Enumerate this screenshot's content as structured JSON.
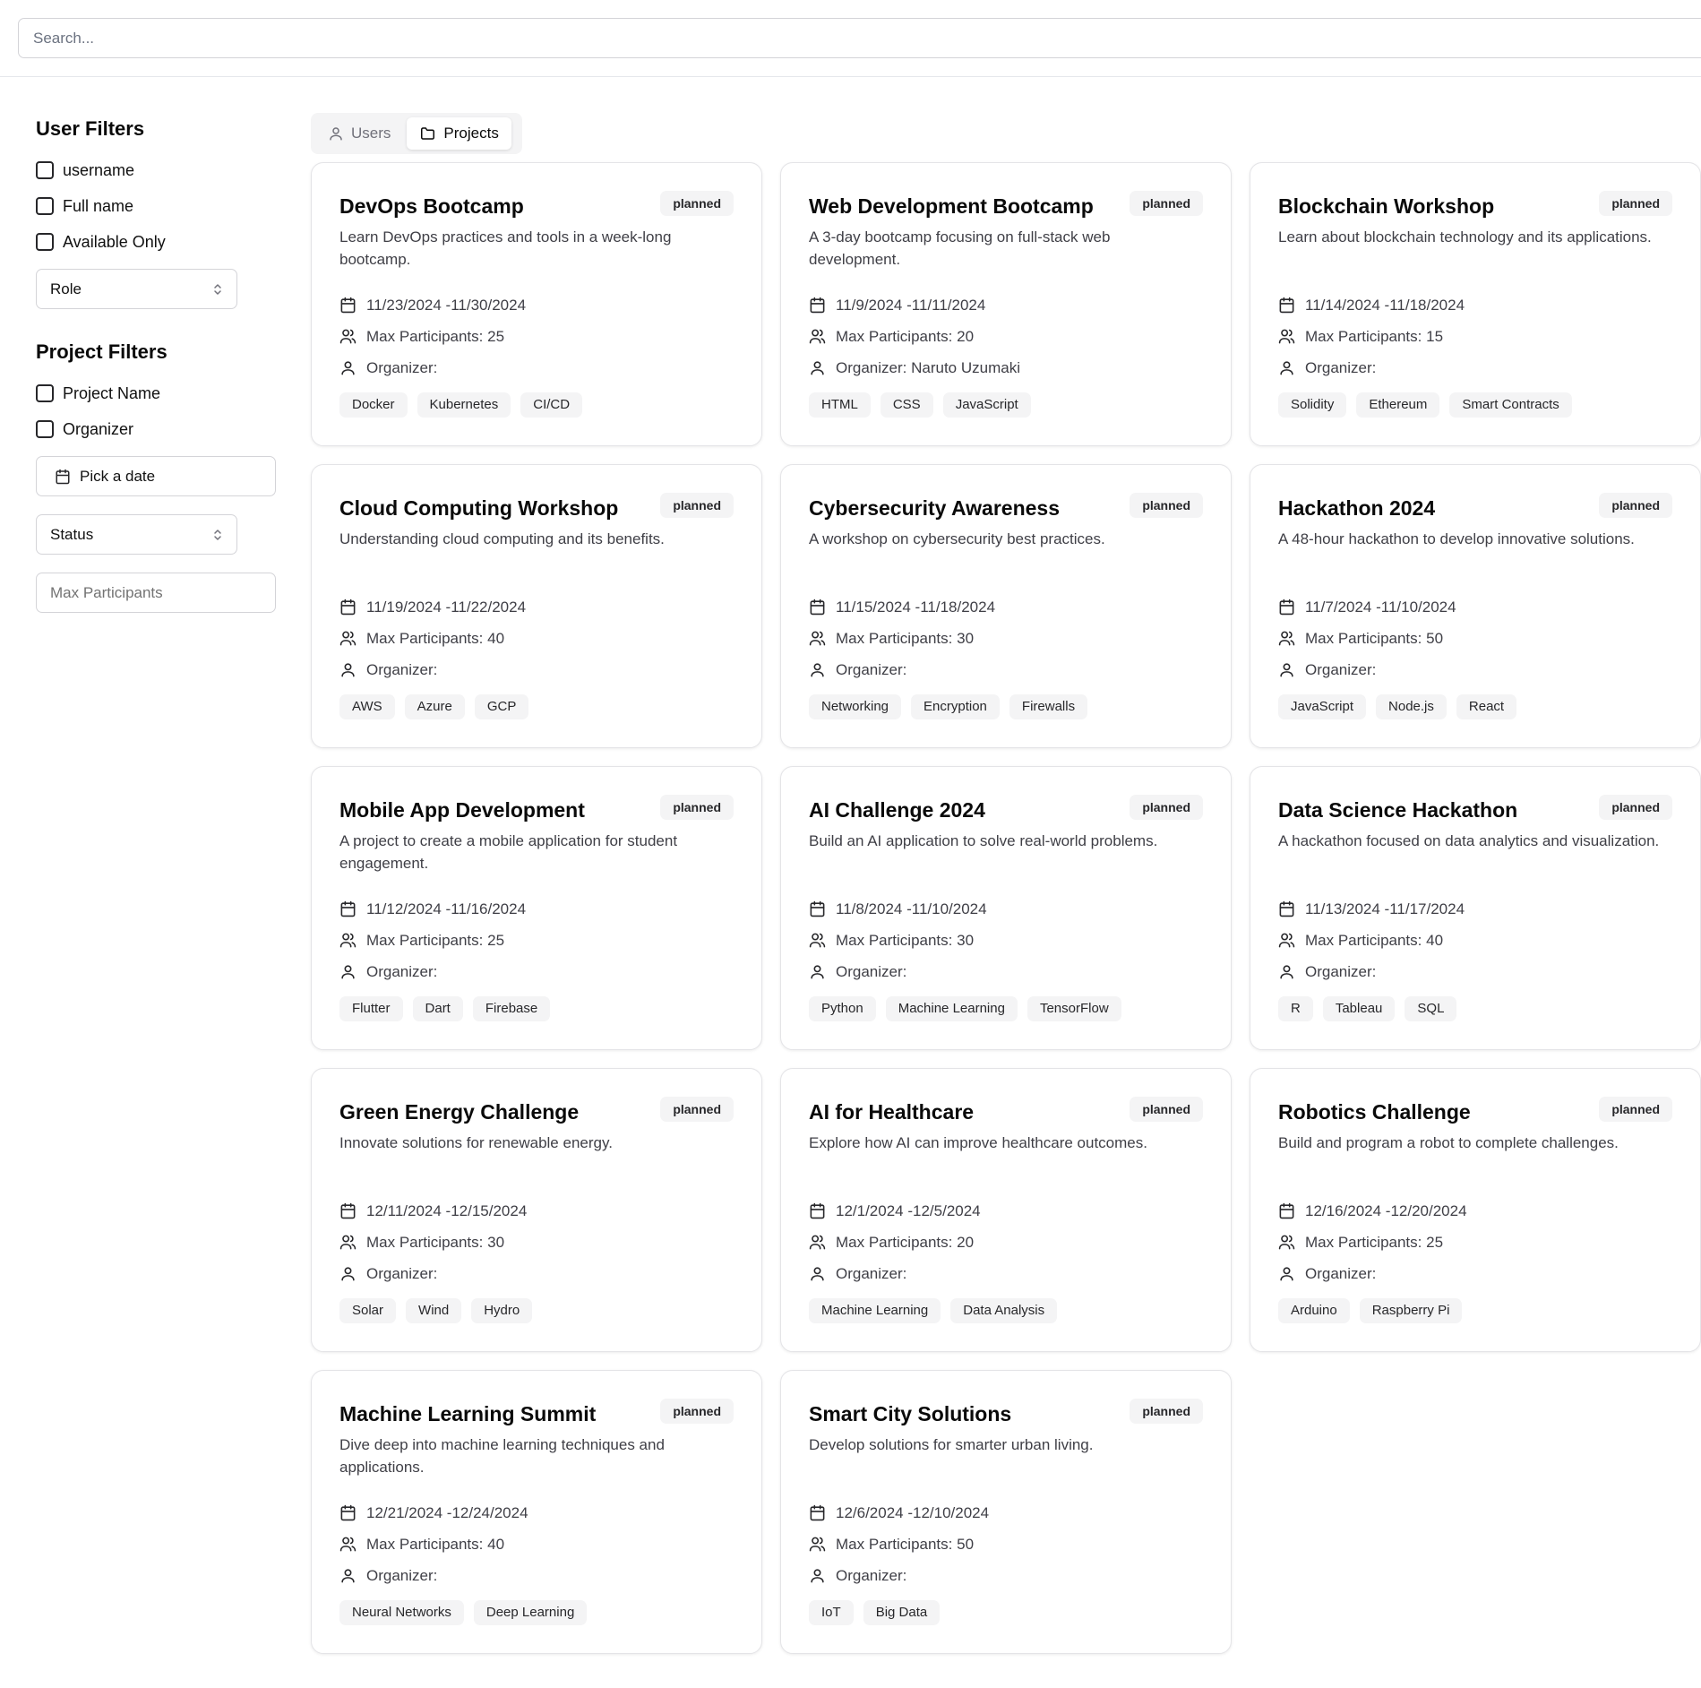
{
  "search": {
    "placeholder": "Search..."
  },
  "sidebar": {
    "user_filters_title": "User Filters",
    "user_checkboxes": [
      "username",
      "Full name",
      "Available Only"
    ],
    "role_select": "Role",
    "project_filters_title": "Project Filters",
    "project_checkboxes": [
      "Project Name",
      "Organizer"
    ],
    "date_picker": "Pick a date",
    "status_select": "Status",
    "max_participants_placeholder": "Max Participants"
  },
  "tabs": [
    {
      "label": "Users",
      "icon": "user-icon",
      "active": false
    },
    {
      "label": "Projects",
      "icon": "folder-icon",
      "active": true
    }
  ],
  "labels": {
    "max_participants": "Max Participants: ",
    "organizer": "Organizer: "
  },
  "projects": [
    {
      "title": "DevOps Bootcamp",
      "status": "planned",
      "description": "Learn DevOps practices and tools in a week-long bootcamp.",
      "dates": "11/23/2024 -11/30/2024",
      "max": "25",
      "organizer": "",
      "tags": [
        "Docker",
        "Kubernetes",
        "CI/CD"
      ]
    },
    {
      "title": "Web Development Bootcamp",
      "status": "planned",
      "description": "A 3-day bootcamp focusing on full-stack web development.",
      "dates": "11/9/2024 -11/11/2024",
      "max": "20",
      "organizer": "Naruto Uzumaki",
      "tags": [
        "HTML",
        "CSS",
        "JavaScript"
      ]
    },
    {
      "title": "Blockchain Workshop",
      "status": "planned",
      "description": "Learn about blockchain technology and its applications.",
      "dates": "11/14/2024 -11/18/2024",
      "max": "15",
      "organizer": "",
      "tags": [
        "Solidity",
        "Ethereum",
        "Smart Contracts"
      ]
    },
    {
      "title": "Cloud Computing Workshop",
      "status": "planned",
      "description": "Understanding cloud computing and its benefits.",
      "dates": "11/19/2024 -11/22/2024",
      "max": "40",
      "organizer": "",
      "tags": [
        "AWS",
        "Azure",
        "GCP"
      ]
    },
    {
      "title": "Cybersecurity Awareness",
      "status": "planned",
      "description": "A workshop on cybersecurity best practices.",
      "dates": "11/15/2024 -11/18/2024",
      "max": "30",
      "organizer": "",
      "tags": [
        "Networking",
        "Encryption",
        "Firewalls"
      ]
    },
    {
      "title": "Hackathon 2024",
      "status": "planned",
      "description": "A 48-hour hackathon to develop innovative solutions.",
      "dates": "11/7/2024 -11/10/2024",
      "max": "50",
      "organizer": "",
      "tags": [
        "JavaScript",
        "Node.js",
        "React"
      ]
    },
    {
      "title": "Mobile App Development",
      "status": "planned",
      "description": "A project to create a mobile application for student engagement.",
      "dates": "11/12/2024 -11/16/2024",
      "max": "25",
      "organizer": "",
      "tags": [
        "Flutter",
        "Dart",
        "Firebase"
      ]
    },
    {
      "title": "AI Challenge 2024",
      "status": "planned",
      "description": "Build an AI application to solve real-world problems.",
      "dates": "11/8/2024 -11/10/2024",
      "max": "30",
      "organizer": "",
      "tags": [
        "Python",
        "Machine Learning",
        "TensorFlow"
      ]
    },
    {
      "title": "Data Science Hackathon",
      "status": "planned",
      "description": "A hackathon focused on data analytics and visualization.",
      "dates": "11/13/2024 -11/17/2024",
      "max": "40",
      "organizer": "",
      "tags": [
        "R",
        "Tableau",
        "SQL"
      ]
    },
    {
      "title": "Green Energy Challenge",
      "status": "planned",
      "description": "Innovate solutions for renewable energy.",
      "dates": "12/11/2024 -12/15/2024",
      "max": "30",
      "organizer": "",
      "tags": [
        "Solar",
        "Wind",
        "Hydro"
      ]
    },
    {
      "title": "AI for Healthcare",
      "status": "planned",
      "description": "Explore how AI can improve healthcare outcomes.",
      "dates": "12/1/2024 -12/5/2024",
      "max": "20",
      "organizer": "",
      "tags": [
        "Machine Learning",
        "Data Analysis"
      ]
    },
    {
      "title": "Robotics Challenge",
      "status": "planned",
      "description": "Build and program a robot to complete challenges.",
      "dates": "12/16/2024 -12/20/2024",
      "max": "25",
      "organizer": "",
      "tags": [
        "Arduino",
        "Raspberry Pi"
      ]
    },
    {
      "title": "Machine Learning Summit",
      "status": "planned",
      "description": "Dive deep into machine learning techniques and applications.",
      "dates": "12/21/2024 -12/24/2024",
      "max": "40",
      "organizer": "",
      "tags": [
        "Neural Networks",
        "Deep Learning"
      ]
    },
    {
      "title": "Smart City Solutions",
      "status": "planned",
      "description": "Develop solutions for smarter urban living.",
      "dates": "12/6/2024 -12/10/2024",
      "max": "50",
      "organizer": "",
      "tags": [
        "IoT",
        "Big Data"
      ]
    }
  ]
}
